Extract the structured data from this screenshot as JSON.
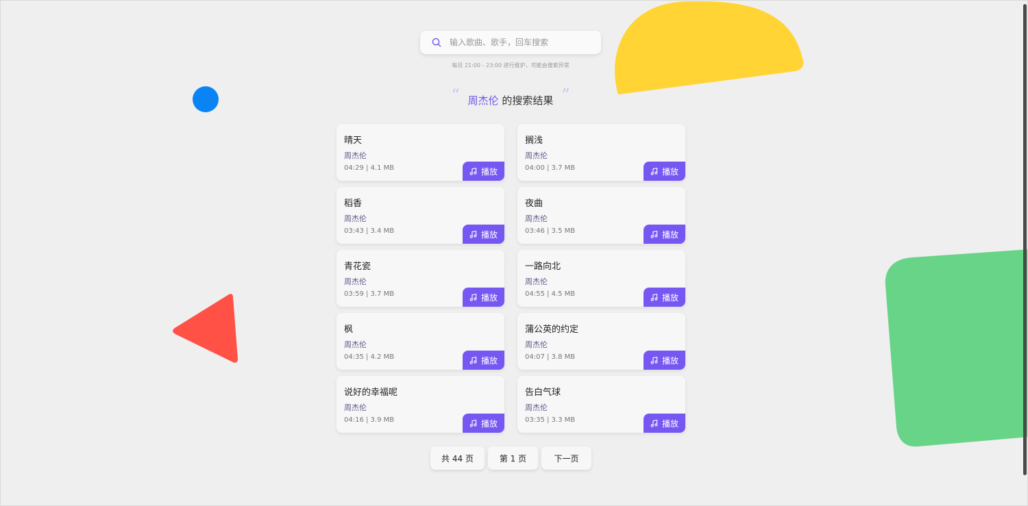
{
  "search": {
    "placeholder": "输入歌曲、歌手，回车搜索",
    "value": "",
    "notice": "每日 21:00 - 23:00 进行维护，可能会搜索异常"
  },
  "heading": {
    "open_quote": "“",
    "artist": "周杰伦",
    "suffix": " 的搜索结果",
    "close_quote": "”"
  },
  "play_label": "播放",
  "songs": [
    {
      "title": "晴天",
      "artist": "周杰伦",
      "meta": "04:29 | 4.1 MB"
    },
    {
      "title": "搁浅",
      "artist": "周杰伦",
      "meta": "04:00 | 3.7 MB"
    },
    {
      "title": "稻香",
      "artist": "周杰伦",
      "meta": "03:43 | 3.4 MB"
    },
    {
      "title": "夜曲",
      "artist": "周杰伦",
      "meta": "03:46 | 3.5 MB"
    },
    {
      "title": "青花瓷",
      "artist": "周杰伦",
      "meta": "03:59 | 3.7 MB"
    },
    {
      "title": "一路向北",
      "artist": "周杰伦",
      "meta": "04:55 | 4.5 MB"
    },
    {
      "title": "枫",
      "artist": "周杰伦",
      "meta": "04:35 | 4.2 MB"
    },
    {
      "title": "蒲公英的约定",
      "artist": "周杰伦",
      "meta": "04:07 | 3.8 MB"
    },
    {
      "title": "说好的幸福呢",
      "artist": "周杰伦",
      "meta": "04:16 | 3.9 MB"
    },
    {
      "title": "告白气球",
      "artist": "周杰伦",
      "meta": "03:35 | 3.3 MB"
    }
  ],
  "pagination": {
    "total": "共 44 页",
    "current": "第 1 页",
    "next": "下一页"
  },
  "colors": {
    "accent": "#7657f2",
    "yellow_shape": "#ffd434",
    "blue_shape": "#0a84f5",
    "red_shape": "#ff5145",
    "green_shape": "#68d487"
  },
  "icons": {
    "search": "search-icon",
    "play": "music-note-icon"
  }
}
